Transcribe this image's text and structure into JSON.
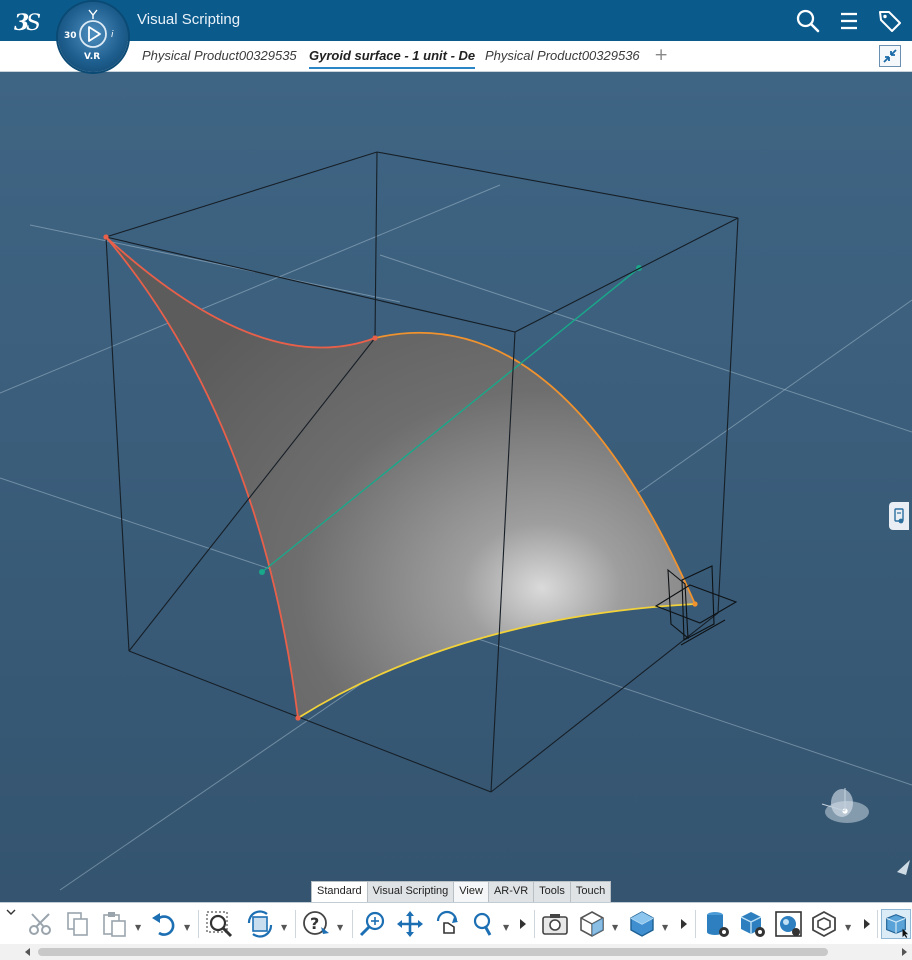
{
  "app": {
    "title": "Visual Scripting",
    "compass": {
      "label_30": "30",
      "label_vr": "V.R",
      "label_i": "i"
    }
  },
  "tabs": [
    {
      "label": "Physical Product00329535"
    },
    {
      "label": "Gyroid surface - 1 unit - De"
    },
    {
      "label": "Physical Product00329536"
    }
  ],
  "tab_add": "+",
  "category_tabs": [
    {
      "label": "Standard"
    },
    {
      "label": "Visual Scripting"
    },
    {
      "label": "View"
    },
    {
      "label": "AR-VR"
    },
    {
      "label": "Tools"
    },
    {
      "label": "Touch"
    }
  ],
  "colors": {
    "brand_blue": "#0a5a8c",
    "viewport": "#3f6382",
    "edge_red": "#e8604a",
    "edge_orange": "#f0922e",
    "edge_yellow": "#f2d23a",
    "axis_teal": "#19a88a"
  },
  "icons": [
    "search-icon",
    "menu-icon",
    "tag-icon",
    "collapse-icon",
    "cut-icon",
    "copy-icon",
    "paste-icon",
    "undo-icon",
    "zoom-area-icon",
    "rotate-icon",
    "help-icon",
    "zoom-icon",
    "pan-icon",
    "rotate-view-icon",
    "zoom-in-out-icon",
    "capture-icon",
    "view-mode-icon",
    "cube-icon",
    "database-icon",
    "render-settings-icon",
    "ambiance-icon",
    "hexagon-icon",
    "display-options-icon"
  ]
}
